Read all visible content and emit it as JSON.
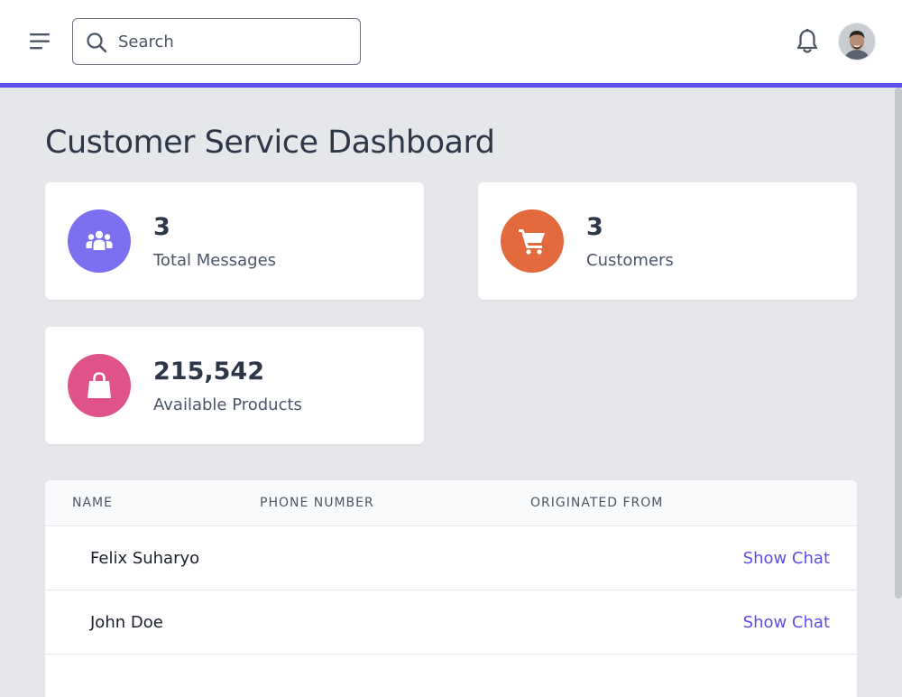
{
  "header": {
    "search_placeholder": "Search"
  },
  "page": {
    "title": "Customer Service Dashboard"
  },
  "stats": [
    {
      "value": "3",
      "label": "Total Messages",
      "icon": "people-icon",
      "color": "#7c6ff0"
    },
    {
      "value": "3",
      "label": "Customers",
      "icon": "cart-icon",
      "color": "#e26a3c"
    },
    {
      "value": "215,542",
      "label": "Available Products",
      "icon": "shopping-bag-icon",
      "color": "#e0538a"
    }
  ],
  "table": {
    "columns": [
      "NAME",
      "PHONE NUMBER",
      "ORIGINATED FROM"
    ],
    "rows": [
      {
        "name": "Felix Suharyo",
        "phone": "",
        "origin": "",
        "action": "Show Chat"
      },
      {
        "name": "John Doe",
        "phone": "",
        "origin": "",
        "action": "Show Chat"
      }
    ]
  },
  "colors": {
    "accent": "#5b4fe9",
    "background": "#e5e7eb"
  }
}
